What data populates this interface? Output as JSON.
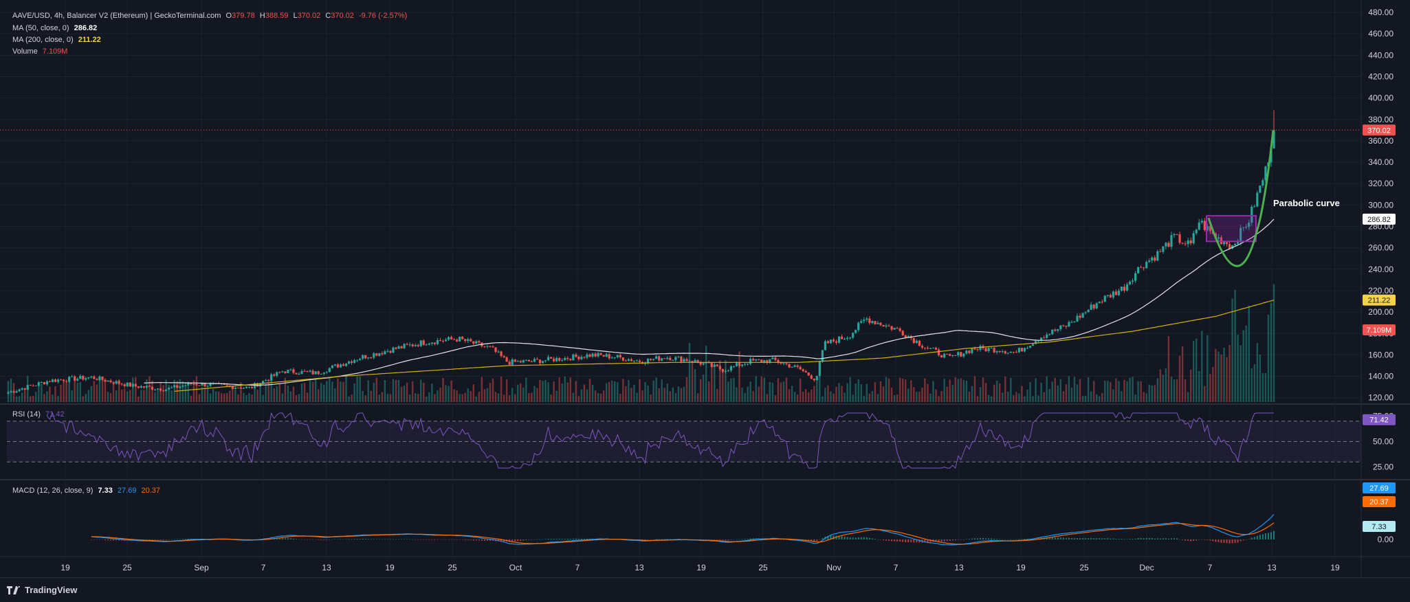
{
  "header": {
    "symbol": "AAVE/USD, 4h, Balancer V2 (Ethereum) | GeckoTerminal.com",
    "o_label": "O",
    "o": "379.78",
    "h_label": "H",
    "h": "388.59",
    "l_label": "L",
    "l": "370.02",
    "c_label": "C",
    "c": "370.02",
    "change": "-9.76 (-2.57%)",
    "ma50_label": "MA (50, close, 0)",
    "ma50": "286.82",
    "ma200_label": "MA (200, close, 0)",
    "ma200": "211.22",
    "volume_label": "Volume",
    "volume": "7.109M",
    "rsi_label": "RSI (14)",
    "rsi": "71.42",
    "macd_label": "MACD (12, 26, close, 9)",
    "macd": "7.33",
    "macd_signal": "27.69",
    "macd_hist": "20.37"
  },
  "annotation": "Parabolic curve",
  "branding": "TradingView",
  "colors": {
    "up": "#26a69a",
    "down": "#ef5350",
    "ma50": "#e0e3eb",
    "ma200": "#d4b106",
    "rsi": "#7e57c2",
    "macd": "#2196f3",
    "signal": "#ff6d00",
    "curve": "#4caf50",
    "box": "#9c27b0"
  },
  "price_badges": {
    "last": "370.02",
    "ma50": "286.82",
    "ma200": "211.22",
    "volume": "7.109M"
  },
  "rsi_badge": "71.42",
  "macd_badges": {
    "macd": "27.69",
    "signal": "20.37",
    "hist": "7.33"
  },
  "chart_data": {
    "type": "candlestick",
    "interval": "4h",
    "ylim": [
      120,
      480
    ],
    "y_ticks": [
      "480.00",
      "460.00",
      "440.00",
      "420.00",
      "400.00",
      "380.00",
      "360.00",
      "340.00",
      "320.00",
      "300.00",
      "280.00",
      "260.00",
      "240.00",
      "220.00",
      "200.00",
      "180.00",
      "160.00",
      "140.00",
      "120.00"
    ],
    "x_ticks": [
      "19",
      "25",
      "Sep",
      "7",
      "13",
      "19",
      "25",
      "Oct",
      "7",
      "13",
      "19",
      "25",
      "Nov",
      "7",
      "13",
      "19",
      "25",
      "Dec",
      "7",
      "13",
      "19"
    ],
    "close_waypoints": [
      [
        0,
        125
      ],
      [
        5,
        136
      ],
      [
        10,
        139
      ],
      [
        15,
        131
      ],
      [
        19,
        128
      ],
      [
        22,
        133
      ],
      [
        26,
        131
      ],
      [
        29,
        129
      ],
      [
        33,
        145
      ],
      [
        37,
        143
      ],
      [
        42,
        157
      ],
      [
        46,
        165
      ],
      [
        50,
        172
      ],
      [
        54,
        175
      ],
      [
        58,
        166
      ],
      [
        60,
        153
      ],
      [
        63,
        154
      ],
      [
        67,
        157
      ],
      [
        70,
        160
      ],
      [
        73,
        158
      ],
      [
        76,
        154
      ],
      [
        79,
        158
      ],
      [
        82,
        155
      ],
      [
        86,
        146
      ],
      [
        89,
        154
      ],
      [
        92,
        155
      ],
      [
        95,
        147
      ],
      [
        97,
        137
      ],
      [
        98,
        170
      ],
      [
        101,
        178
      ],
      [
        103,
        194
      ],
      [
        107,
        183
      ],
      [
        110,
        168
      ],
      [
        113,
        157
      ],
      [
        116,
        166
      ],
      [
        119,
        165
      ],
      [
        121,
        162
      ],
      [
        124,
        177
      ],
      [
        127,
        187
      ],
      [
        129,
        198
      ],
      [
        131,
        210
      ],
      [
        134,
        223
      ],
      [
        136,
        243
      ],
      [
        138,
        254
      ],
      [
        140,
        270
      ],
      [
        142,
        262
      ],
      [
        143,
        285
      ],
      [
        145,
        270
      ],
      [
        147,
        262
      ],
      [
        149,
        286
      ],
      [
        151,
        332
      ],
      [
        152,
        370
      ]
    ],
    "ma200_waypoints": [
      [
        0,
        117
      ],
      [
        20,
        126
      ],
      [
        40,
        140
      ],
      [
        60,
        150
      ],
      [
        80,
        153
      ],
      [
        95,
        153
      ],
      [
        105,
        157
      ],
      [
        115,
        166
      ],
      [
        125,
        172
      ],
      [
        135,
        182
      ],
      [
        145,
        196
      ],
      [
        152,
        211.22
      ]
    ],
    "volume_label": "7.109M",
    "rsi": {
      "ylim": [
        20,
        80
      ],
      "levels": [
        70,
        50,
        30
      ],
      "ticks": [
        "75.00",
        "50.00",
        "25.00"
      ],
      "last": 71.42
    },
    "macd": {
      "ticks": [
        "0.00"
      ],
      "macd_last": 27.69,
      "signal_last": 20.37,
      "hist_last": 7.33
    }
  }
}
